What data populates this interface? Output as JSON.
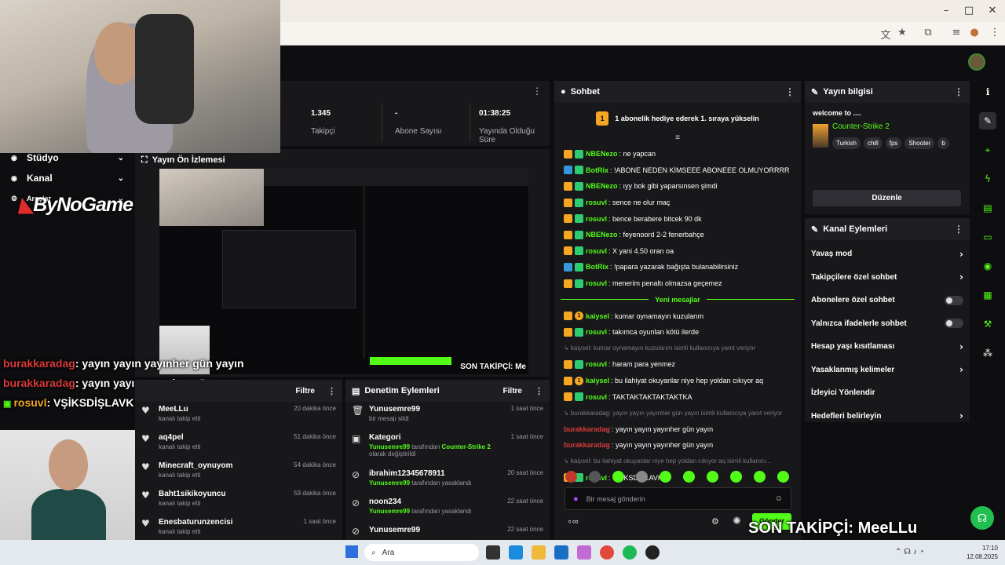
{
  "browser": {
    "icons": [
      "translate-icon",
      "star-icon",
      "extension-icon",
      "media-icon",
      "profile-icon",
      "menu-icon"
    ]
  },
  "sidebar": {
    "items": [
      {
        "label": "Stüdyo",
        "icon": "studio-icon"
      },
      {
        "label": "Kanal",
        "icon": "channel-icon"
      },
      {
        "label": "Araçlar",
        "icon": "tools-icon"
      }
    ]
  },
  "stats": [
    {
      "value": "1.345",
      "label": "Takipçi"
    },
    {
      "value": "-",
      "label": "Abone Sayısı"
    },
    {
      "value": "01:38:25",
      "label": "Yayında Olduğu Süre"
    }
  ],
  "preview": {
    "title": "Yayın Ön İzlemesi",
    "overlay_follower": "SON TAKİPÇİ: Me"
  },
  "logo": {
    "text": "ByNoGame"
  },
  "overlay_chat": [
    {
      "user": "burakkaradag",
      "text": ": yayın yayın yayınher gün yayın",
      "color": "#d83a3a"
    },
    {
      "user": "burakkaradag",
      "text": ": yayın yayın yayınher gün yayın",
      "color": "#d83a3a"
    },
    {
      "user": "rosuvl",
      "text": ": VŞİKSDİŞLAVK",
      "color": "#f5a623"
    }
  ],
  "activity": {
    "title": "Etkinlik Akışı",
    "filter": "Filtre",
    "items": [
      {
        "name": "MeeLLu",
        "sub": "kanalı takip etti",
        "time": "20 dakika önce"
      },
      {
        "name": "aq4pel",
        "sub": "kanalı takip etti",
        "time": "51 dakika önce"
      },
      {
        "name": "Minecraft_oynuyom",
        "sub": "kanalı takip etti",
        "time": "54 dakika önce"
      },
      {
        "name": "Baht1sikikoyuncu",
        "sub": "kanalı takip etti",
        "time": "59 dakika önce"
      },
      {
        "name": "Enesbaturunzencisi",
        "sub": "kanalı takip etti",
        "time": "1 saat önce"
      }
    ]
  },
  "moderation": {
    "title": "Denetim Eylemleri",
    "filter": "Filtre",
    "items": [
      {
        "name": "Yunusemre99",
        "sub": "bir mesajı sildi",
        "time": "1 saat önce",
        "icon": "trash-icon"
      },
      {
        "name": "Kategori",
        "sub_user": "Yunusemre99",
        "sub_mid": "tarafından",
        "sub_game": "Counter-Strike 2",
        "sub_end": "olarak değiştirildi",
        "time": "1 saat önce",
        "icon": "category-icon"
      },
      {
        "name": "ibrahim12345678911",
        "sub_user": "Yunusemre99",
        "sub_end": "tarafından yasaklandı",
        "time": "20 saat önce",
        "icon": "ban-icon"
      },
      {
        "name": "noon234",
        "sub_user": "Yunusemre99",
        "sub_end": "tarafından yasaklandı",
        "time": "22 saat önce",
        "icon": "ban-icon"
      },
      {
        "name": "Yunusemre99",
        "time": "22 saat önce",
        "icon": "ban-icon"
      }
    ]
  },
  "chat": {
    "title": "Sohbet",
    "pinned": "1 abonelik hediye ederek 1. sıraya yükselin",
    "pinned_rank": "1",
    "messages": [
      {
        "user": "NBENezo",
        "text": ": ne yapcan",
        "color": "#53fc18",
        "badges": [
          "crown",
          "sub"
        ]
      },
      {
        "user": "BotRix",
        "text": ": !ABONE NEDEN KİMSEEE ABONEEE OLMUYORRRR",
        "color": "#53fc18",
        "badges": [
          "bot",
          "sub"
        ]
      },
      {
        "user": "NBENezo",
        "text": ": ıyy bok gibi yaparsınsen şimdi",
        "color": "#53fc18",
        "badges": [
          "crown",
          "sub"
        ]
      },
      {
        "user": "rosuvl",
        "text": ": sence ne olur maç",
        "color": "#53fc18",
        "badges": [
          "crown",
          "sub"
        ]
      },
      {
        "user": "rosuvl",
        "text": ": bence berabere bitcek 90 dk",
        "color": "#53fc18",
        "badges": [
          "crown",
          "sub"
        ]
      },
      {
        "user": "NBENezo",
        "text": ": feyenoord 2-2 fenerbahçe",
        "color": "#53fc18",
        "badges": [
          "crown",
          "sub"
        ]
      },
      {
        "user": "rosuvl",
        "text": ": X yani 4.50 oran oa",
        "color": "#53fc18",
        "badges": [
          "crown",
          "sub"
        ]
      },
      {
        "user": "BotRix",
        "text": ": !papara yazarak bağışta bulanabilirsiniz",
        "color": "#53fc18",
        "badges": [
          "bot",
          "sub"
        ]
      },
      {
        "user": "rosuvl",
        "text": ": menerim penaltı olmazsa geçemez",
        "color": "#53fc18",
        "badges": [
          "crown",
          "sub"
        ]
      }
    ],
    "new_messages": "Yeni mesajlar",
    "messages2": [
      {
        "user": "kaiysel",
        "text": ": kumar oynamayın kuzularım",
        "color": "#53fc18",
        "badges": [
          "crown",
          "one"
        ]
      },
      {
        "user": "rosuvl",
        "text": ": takımca oyunları kötü ilerde",
        "color": "#53fc18",
        "badges": [
          "crown",
          "sub"
        ]
      },
      {
        "reply": "↳ kaiysel: kumar oynamayın kuzularım isimli kullanıcıya yanıt veriyor"
      },
      {
        "user": "rosuvl",
        "text": ": haram para yenmez",
        "color": "#53fc18",
        "badges": [
          "crown",
          "sub"
        ]
      },
      {
        "user": "kaiysel",
        "text": ": bu ilahiyat okuyanlar niye hep yoldan cıkıyor aq",
        "color": "#53fc18",
        "badges": [
          "crown",
          "one"
        ]
      },
      {
        "user": "rosuvl",
        "text": ": TAKTAKTAKTAKTAKTKA",
        "color": "#53fc18",
        "badges": [
          "crown",
          "sub"
        ]
      },
      {
        "reply": "↳ burakkaradag: yayın yayın yayınher gün yayın isimli kullanıcıya yanıt veriyor"
      },
      {
        "user": "burakkaradag",
        "text": ": yayın yayın yayınher gün yayın",
        "color": "#d83a3a",
        "badges": []
      },
      {
        "user": "burakkaradag",
        "text": ": yayın yayın yayınher gün yayın",
        "color": "#d83a3a",
        "badges": []
      },
      {
        "reply": "↳ kaiysel: bu ilahiyat okuyanlar niye hep yoldan cıkıyor aq isimli kullanıcı..."
      },
      {
        "user": "rosuvl",
        "text": ": VŞİKSDİŞLAVK",
        "color": "#53fc18",
        "badges": [
          "crown",
          "sub"
        ]
      }
    ],
    "input_placeholder": "Bir mesaj gönderin",
    "send": "Gönder",
    "emote_colors": [
      "#c0392b",
      "#555",
      "#53fc18",
      "#888",
      "#53fc18",
      "#53fc18",
      "#53fc18",
      "#53fc18",
      "#53fc18",
      "#53fc18"
    ]
  },
  "stream_info": {
    "title": "Yayın bilgisi",
    "stream_title": "welcome to ....",
    "game": "Counter-Strike 2",
    "tags": [
      "Turkish",
      "chill",
      "fps",
      "Shooter",
      "b"
    ],
    "edit": "Düzenle"
  },
  "channel_actions": {
    "title": "Kanal Eylemleri",
    "items": [
      {
        "label": "Yavaş mod",
        "control": "chevron"
      },
      {
        "label": "Takipçilere özel sohbet",
        "control": "chevron"
      },
      {
        "label": "Abonelere özel sohbet",
        "control": "toggle"
      },
      {
        "label": "Yalnızca ifadelerle sohbet",
        "control": "toggle"
      },
      {
        "label": "Hesap yaşı kısıtlaması",
        "control": "chevron"
      },
      {
        "label": "Yasaklanmış kelimeler",
        "control": "chevron"
      },
      {
        "label": "İzleyici Yönlendir",
        "control": "none"
      },
      {
        "label": "Hedefleri belirleyin",
        "control": "chevron"
      }
    ]
  },
  "overlay_follower": "SON TAKİPÇİ: MeeLLu",
  "taskbar": {
    "search": "Ara",
    "time": "17:10",
    "date": "12.08.2025"
  }
}
